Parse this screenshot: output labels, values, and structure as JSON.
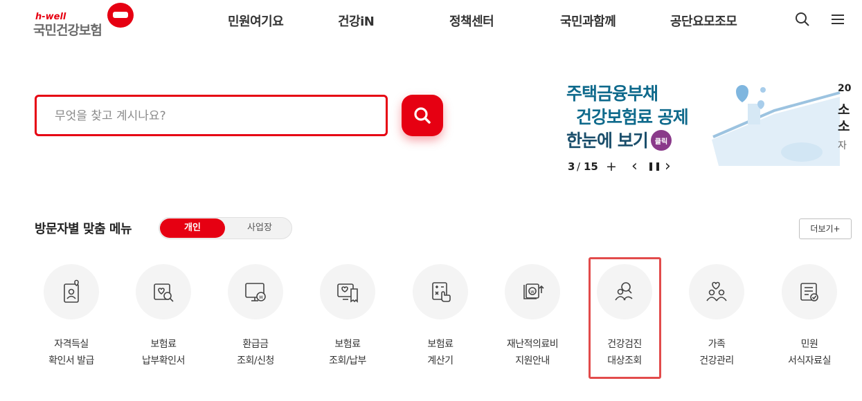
{
  "header": {
    "logo_hwell": "h-well",
    "logo_name": "국민건강보험",
    "nav": [
      "민원여기요",
      "건강iN",
      "정책센터",
      "국민과함께",
      "공단요모조모"
    ],
    "icons": [
      "search-icon",
      "menu-icon"
    ]
  },
  "search": {
    "placeholder": "무엇을 찾고 계시나요?",
    "button_icon": "search-icon"
  },
  "banner": {
    "line1": "주택금융부채",
    "line2": "건강보험료 공제",
    "line3": "한눈에 보기",
    "click_badge": "클릭",
    "right_year": "20",
    "right_text1": "소",
    "right_text2": "소",
    "right_text3": "자",
    "colors": {
      "title": "#0f6a8c",
      "accent": "#8a3a8a"
    }
  },
  "carousel": {
    "current": "3",
    "total": "15",
    "separator": "/",
    "add": "+",
    "prev": "‹",
    "pause": "❚❚",
    "next": "›"
  },
  "section": {
    "title": "방문자별 맞춤 메뉴",
    "toggle_active": "개인",
    "toggle_inactive": "사업장",
    "more": "더보기+"
  },
  "menu": [
    {
      "line1": "자격득실",
      "line2": "확인서 발급",
      "icon": "id-card-heart-icon"
    },
    {
      "line1": "보험료",
      "line2": "납부확인서",
      "icon": "document-search-icon"
    },
    {
      "line1": "환급금",
      "line2": "조회/신청",
      "icon": "monitor-won-icon"
    },
    {
      "line1": "보험료",
      "line2": "조회/납부",
      "icon": "receipt-monitor-icon"
    },
    {
      "line1": "보험료",
      "line2": "계산기",
      "icon": "calculator-icon"
    },
    {
      "line1": "재난적의료비",
      "line2": "지원안내",
      "icon": "won-card-icon"
    },
    {
      "line1": "건강검진",
      "line2": "대상조회",
      "icon": "people-search-icon"
    },
    {
      "line1": "가족",
      "line2": "건강관리",
      "icon": "family-heart-icon"
    },
    {
      "line1": "민원",
      "line2": "서식자료실",
      "icon": "form-check-icon"
    }
  ],
  "colors": {
    "brand": "#e60012",
    "highlight": "#e24b4b"
  }
}
